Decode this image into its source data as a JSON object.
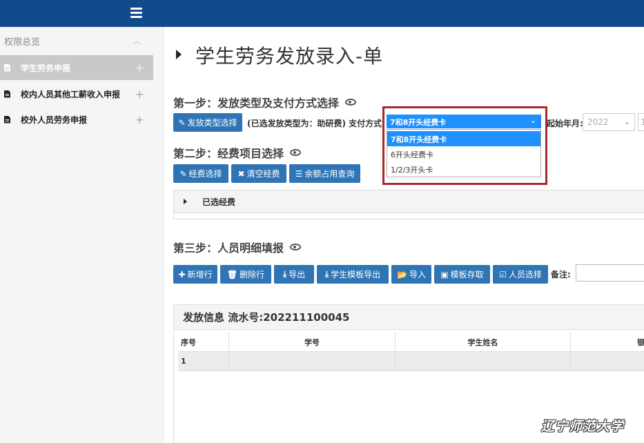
{
  "sidebar": {
    "header": "权限总览",
    "items": [
      {
        "label": "学生劳务申报",
        "active": true
      },
      {
        "label": "校内人员其他工薪收入申报",
        "active": false
      },
      {
        "label": "校外人员劳务申报",
        "active": false
      }
    ]
  },
  "page": {
    "title": "学生劳务发放录入-单"
  },
  "step1": {
    "title": "第一步：发放类型及支付方式选择",
    "type_button": "发放类型选择",
    "type_info": "(已选发放类型为：助研费) 支付方式:",
    "payment_selected": "7和8开头经费卡",
    "payment_options": [
      "7和8开头经费卡",
      "6开头经费卡",
      "1/2/3开头卡"
    ],
    "year_label": "起始年月:",
    "year_value": "2022",
    "month_value": "1"
  },
  "step2": {
    "title": "第二步：经费项目选择",
    "buttons": [
      "经费选择",
      "清空经费",
      "余额占用查询"
    ],
    "panel_title": "已选经费"
  },
  "step3": {
    "title": "第三步：人员明细填报",
    "buttons": [
      "新增行",
      "删除行",
      "导出",
      "学生模板导出",
      "导入",
      "模板存取",
      "人员选择"
    ],
    "remark_label": "备注:",
    "remark_value": ""
  },
  "grid": {
    "title": "发放信息 流水号:202211100045",
    "columns": [
      "序号",
      "学号",
      "学生姓名",
      "银"
    ],
    "rows": [
      [
        "1",
        "",
        "",
        ""
      ]
    ]
  },
  "watermark": "辽宁师范大学",
  "colors": {
    "topbar": "#114b8c",
    "button": "#2f74b5",
    "select_highlight": "#1e90ff",
    "annotation_box": "#a52a2a"
  }
}
